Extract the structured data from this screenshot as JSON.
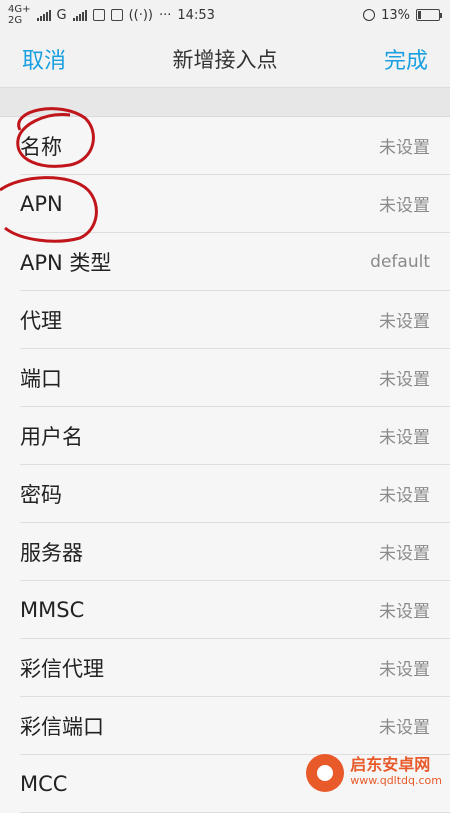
{
  "status": {
    "network_top": "4G+",
    "network_bottom": "2G",
    "carrier_g": "G",
    "more": "···",
    "time": "14:53",
    "battery": "13%"
  },
  "nav": {
    "cancel": "取消",
    "title": "新增接入点",
    "done": "完成"
  },
  "rows": [
    {
      "label": "名称",
      "value": "未设置"
    },
    {
      "label": "APN",
      "value": "未设置"
    },
    {
      "label": "APN 类型",
      "value": "default"
    },
    {
      "label": "代理",
      "value": "未设置"
    },
    {
      "label": "端口",
      "value": "未设置"
    },
    {
      "label": "用户名",
      "value": "未设置"
    },
    {
      "label": "密码",
      "value": "未设置"
    },
    {
      "label": "服务器",
      "value": "未设置"
    },
    {
      "label": "MMSC",
      "value": "未设置"
    },
    {
      "label": "彩信代理",
      "value": "未设置"
    },
    {
      "label": "彩信端口",
      "value": "未设置"
    },
    {
      "label": "MCC",
      "value": ""
    }
  ],
  "watermark": {
    "title": "启东安卓网",
    "url": "www.qdltdq.com"
  },
  "colors": {
    "accent": "#1aa0e0",
    "annotation": "#c0151b",
    "watermark": "#e85a2a"
  }
}
